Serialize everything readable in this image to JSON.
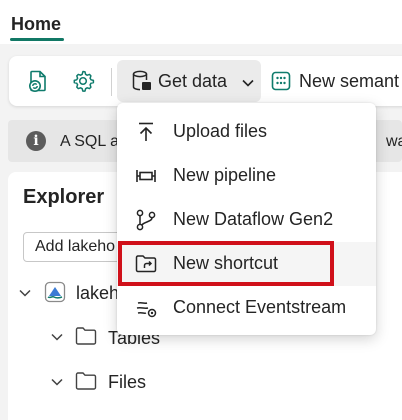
{
  "tabs": {
    "home_label": "Home"
  },
  "ribbon": {
    "get_data_label": "Get data",
    "new_semantic_label": "New semant"
  },
  "infobar": {
    "text_left": "A SQL a",
    "text_right": "was"
  },
  "explorer": {
    "title": "Explorer",
    "add_button_label": "Add lakeho",
    "tree": {
      "lakehouse_label": "lakeh",
      "tables_label": "Tables",
      "files_label": "Files"
    }
  },
  "menu": {
    "items": [
      {
        "label": "Upload files",
        "icon": "upload-icon"
      },
      {
        "label": "New pipeline",
        "icon": "pipeline-icon"
      },
      {
        "label": "New Dataflow Gen2",
        "icon": "dataflow-icon"
      },
      {
        "label": "New shortcut",
        "icon": "folder-shortcut-icon"
      },
      {
        "label": "Connect Eventstream",
        "icon": "eventstream-icon"
      }
    ]
  },
  "colors": {
    "accent": "#117865",
    "highlight": "#d0101a",
    "icon_teal": "#0f7b6c"
  }
}
